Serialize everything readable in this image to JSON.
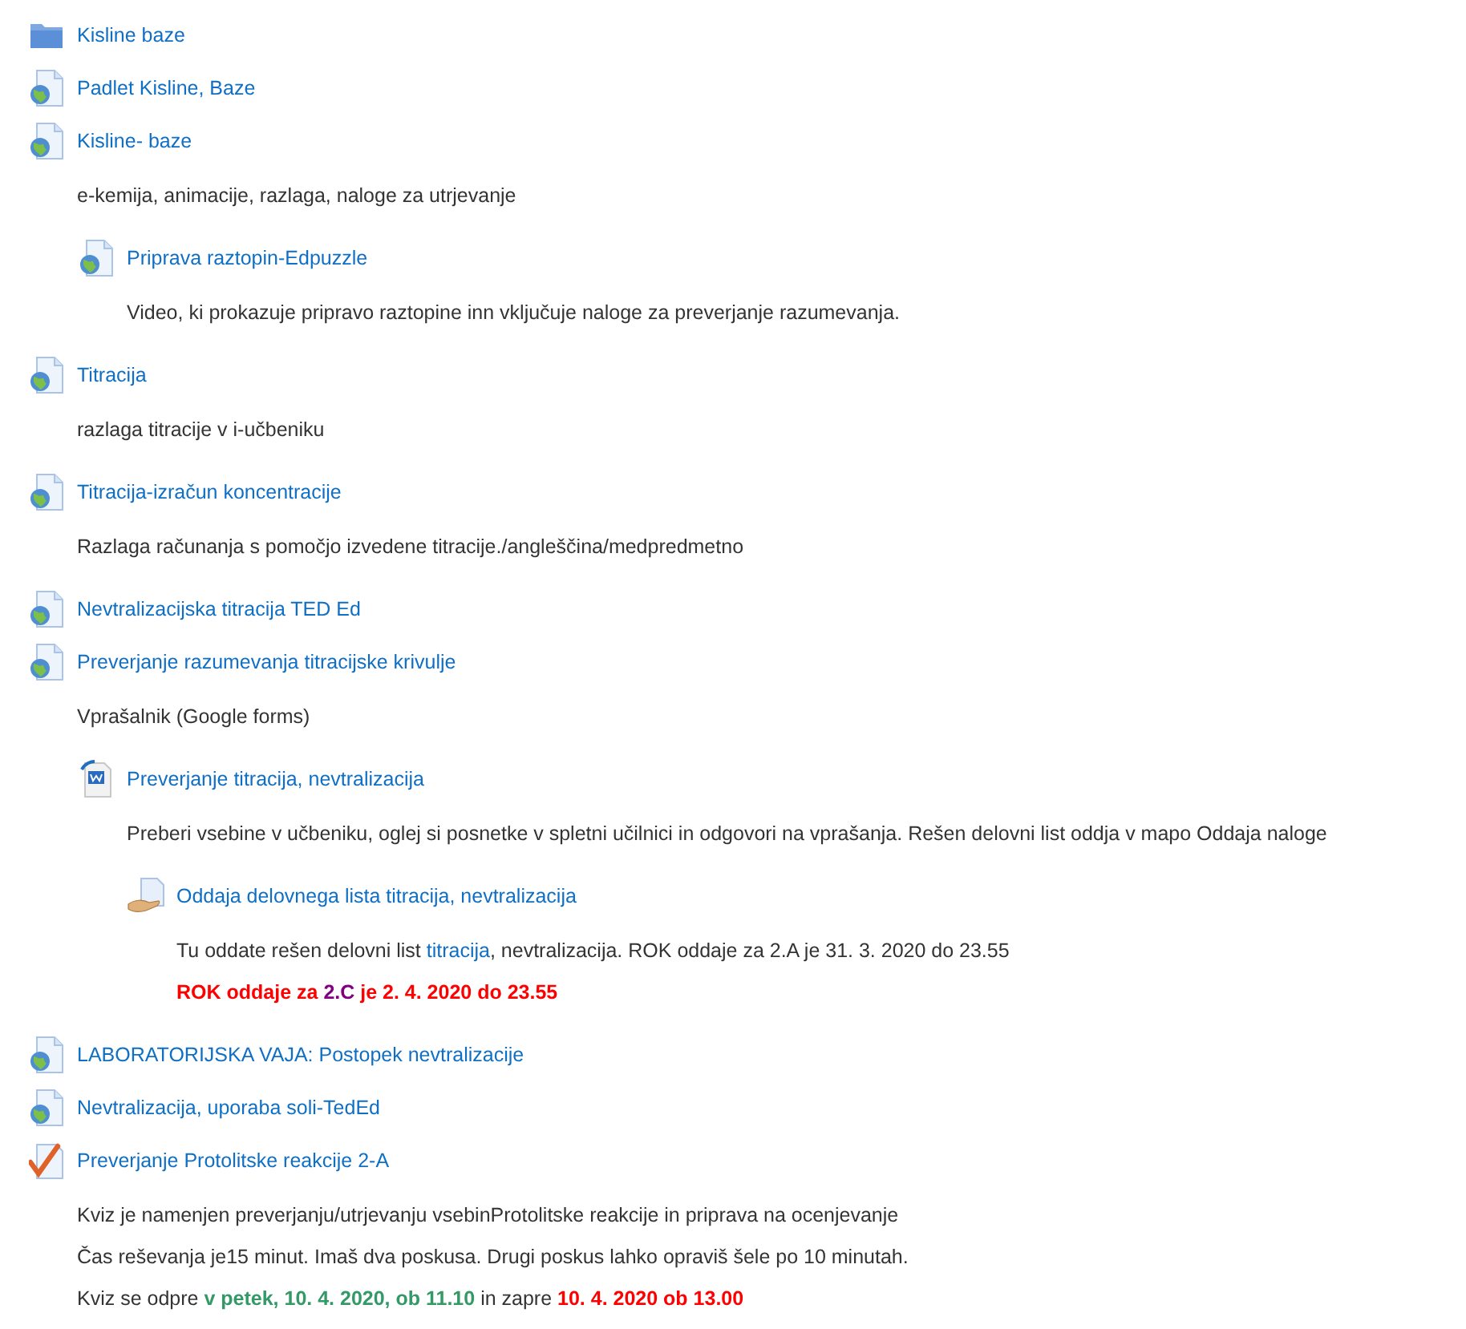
{
  "activities": [
    {
      "kind": "folder",
      "title": "Kisline baze"
    },
    {
      "kind": "url",
      "title": "Padlet Kisline, Baze"
    },
    {
      "kind": "url",
      "title": "Kisline- baze",
      "description": [
        [
          {
            "kind": "plain",
            "text": "e-kemija, animacije, razlaga, naloge za utrjevanje"
          }
        ]
      ],
      "children": [
        {
          "kind": "url",
          "title": "Priprava raztopin-Edpuzzle",
          "description": [
            [
              {
                "kind": "plain",
                "text": "Video, ki prokazuje pripravo raztopine inn vključuje naloge za  preverjanje razumevanja."
              }
            ]
          ]
        }
      ]
    },
    {
      "kind": "url",
      "title": "Titracija",
      "description": [
        [
          {
            "kind": "plain",
            "text": "razlaga titracije v i-učbeniku"
          }
        ]
      ]
    },
    {
      "kind": "url",
      "title": "Titracija-izračun koncentracije",
      "description": [
        [
          {
            "kind": "plain",
            "text": "Razlaga računanja s pomočjo izvedene titracije./angleščina/medpredmetno"
          }
        ]
      ]
    },
    {
      "kind": "url",
      "title": "Nevtralizacijska titracija TED Ed"
    },
    {
      "kind": "url",
      "title": "Preverjanje razumevanja titracijske krivulje",
      "description": [
        [
          {
            "kind": "plain",
            "text": "Vprašalnik (Google forms)"
          }
        ]
      ],
      "children": [
        {
          "kind": "document",
          "title": "Preverjanje titracija, nevtralizacija",
          "description": [
            [
              {
                "kind": "plain",
                "text": "Preberi vsebine v učbeniku, oglej si posnetke v spletni učilnici in odgovori na vprašanja. Rešen delovni list oddja v mapo Oddaja naloge"
              }
            ]
          ],
          "children": [
            {
              "kind": "assignment",
              "title": "Oddaja delovnega lista titracija, nevtralizacija",
              "description": [
                [
                  {
                    "kind": "plain",
                    "text": "Tu oddate rešen delovni list "
                  },
                  {
                    "kind": "link",
                    "text": "titracija"
                  },
                  {
                    "kind": "plain",
                    "text": ", nevtralizacija. ROK oddaje za 2.A je 31. 3. 2020 do 23.55"
                  }
                ],
                [
                  {
                    "kind": "emphasis",
                    "text": "ROK oddaje za ",
                    "color": "#ff0000"
                  },
                  {
                    "kind": "emphasis",
                    "text": "2.C",
                    "color": "#800080"
                  },
                  {
                    "kind": "emphasis",
                    "text": " je 2. 4. 2020 do 23.55",
                    "color": "#ff0000"
                  }
                ]
              ]
            }
          ]
        }
      ]
    },
    {
      "kind": "url",
      "title": "LABORATORIJSKA VAJA: Postopek nevtralizacije"
    },
    {
      "kind": "url",
      "title": "Nevtralizacija, uporaba soli-TedEd"
    },
    {
      "kind": "quiz",
      "title": "Preverjanje Protolitske reakcije 2-A",
      "description": [
        [
          {
            "kind": "plain",
            "text": "Kviz je namenjen preverjanju/utrjevanju vsebinProtolitske reakcije in priprava na ocenjevanje"
          }
        ],
        [
          {
            "kind": "plain",
            "text": "Čas reševanja je15 minut. Imaš dva poskusa. Drugi poskus lahko opraviš šele po 10 minutah."
          }
        ],
        [
          {
            "kind": "plain",
            "text": "Kviz se odpre "
          },
          {
            "kind": "emphasis",
            "text": "v petek, 10. 4. 2020,  ob 11.10",
            "color": "#339966"
          },
          {
            "kind": "plain",
            "text": " in  zapre "
          },
          {
            "kind": "emphasis",
            "text": "10. 4. 2020 ob 13.00",
            "color": "#ff0000"
          }
        ]
      ]
    }
  ]
}
